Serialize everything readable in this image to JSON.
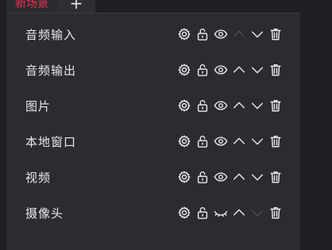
{
  "tabs": {
    "active_label": "新场景",
    "add_label": "+"
  },
  "sources": [
    {
      "name": "音频输入",
      "up_enabled": false,
      "down_enabled": true,
      "visible": true
    },
    {
      "name": "音频输出",
      "up_enabled": true,
      "down_enabled": true,
      "visible": true
    },
    {
      "name": "图片",
      "up_enabled": true,
      "down_enabled": true,
      "visible": true
    },
    {
      "name": "本地窗口",
      "up_enabled": true,
      "down_enabled": true,
      "visible": true
    },
    {
      "name": "视频",
      "up_enabled": true,
      "down_enabled": true,
      "visible": true
    },
    {
      "name": "摄像头",
      "up_enabled": true,
      "down_enabled": false,
      "visible": false
    }
  ],
  "icons": {
    "settings": "gear-icon",
    "lock": "unlock-icon",
    "visibility_on": "eye-icon",
    "visibility_off": "eye-closed-icon",
    "move_up": "chevron-up-icon",
    "move_down": "chevron-down-icon",
    "delete": "trash-icon"
  },
  "colors": {
    "active_tab": "#e8344e",
    "panel_bg": "#2b2c31",
    "page_bg": "#1f2024",
    "icon": "#e8e8ea",
    "icon_disabled": "#4a4b51"
  }
}
